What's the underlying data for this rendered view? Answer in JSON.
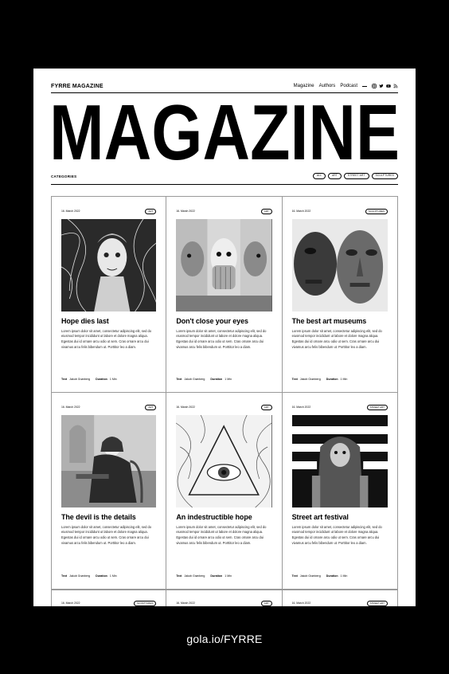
{
  "brand": "FYRRE MAGAZINE",
  "nav": {
    "items": [
      "Magazine",
      "Authors",
      "Podcast"
    ]
  },
  "masthead": "MAGAZINE",
  "categories": {
    "label": "CATEGORIES",
    "filters": [
      "ALL",
      "ART",
      "STREET ART",
      "SCULPTURES"
    ]
  },
  "articles": [
    {
      "date": "16. March 2022",
      "tag": "ART",
      "title": "Hope dies last",
      "excerpt": "Lorem ipsum dolor sit amet, consectetur adipiscing elit, sed do eiusmod tempor incididunt ut labore et dolore magna aliqua. Egestas dui id ornare arcu odio ut sem. Cras ornare arcu dui vivamus arcu felis bibendum ut. Porttitor leo a diam.",
      "text_label": "Text",
      "author": "Jakob Grønberg",
      "duration_label": "Duration",
      "duration": "1 Min"
    },
    {
      "date": "16. March 2022",
      "tag": "ART",
      "title": "Don't close your eyes",
      "excerpt": "Lorem ipsum dolor sit amet, consectetur adipiscing elit, sed do eiusmod tempor incididunt ut labore et dolore magna aliqua. Egestas dui id ornare arcu odio ut sem. Cras ornare arcu dui vivamus arcu felis bibendum ut. Porttitor leo a diam.",
      "text_label": "Text",
      "author": "Jakob Grønberg",
      "duration_label": "Duration",
      "duration": "1 Min"
    },
    {
      "date": "16. March 2022",
      "tag": "SCULPTURES",
      "title": "The best art museums",
      "excerpt": "Lorem ipsum dolor sit amet, consectetur adipiscing elit, sed do eiusmod tempor incididunt ut labore et dolore magna aliqua. Egestas dui id ornare arcu odio ut sem. Cras ornare arcu dui vivamus arcu felis bibendum ut. Porttitor leo a diam.",
      "text_label": "Text",
      "author": "Jakob Grønberg",
      "duration_label": "Duration",
      "duration": "1 Min"
    },
    {
      "date": "16. March 2022",
      "tag": "ART",
      "title": "The devil is the details",
      "excerpt": "Lorem ipsum dolor sit amet, consectetur adipiscing elit, sed do eiusmod tempor incididunt ut labore et dolore magna aliqua. Egestas dui id ornare arcu odio ut sem. Cras ornare arcu dui vivamus arcu felis bibendum ut. Porttitor leo a diam.",
      "text_label": "Text",
      "author": "Jakob Grønberg",
      "duration_label": "Duration",
      "duration": "1 Min"
    },
    {
      "date": "16. March 2022",
      "tag": "ART",
      "title": "An indestructible hope",
      "excerpt": "Lorem ipsum dolor sit amet, consectetur adipiscing elit, sed do eiusmod tempor incididunt ut labore et dolore magna aliqua. Egestas dui id ornare arcu odio ut sem. Cras ornare arcu dui vivamus arcu felis bibendum ut. Porttitor leo a diam.",
      "text_label": "Text",
      "author": "Jakob Grønberg",
      "duration_label": "Duration",
      "duration": "1 Min"
    },
    {
      "date": "16. March 2022",
      "tag": "STREET ART",
      "title": "Street art festival",
      "excerpt": "Lorem ipsum dolor sit amet, consectetur adipiscing elit, sed do eiusmod tempor incididunt ut labore et dolore magna aliqua. Egestas dui id ornare arcu odio ut sem. Cras ornare arcu dui vivamus arcu felis bibendum ut. Porttitor leo a diam.",
      "text_label": "Text",
      "author": "Jakob Grønberg",
      "duration_label": "Duration",
      "duration": "1 Min"
    }
  ],
  "partial_row": [
    {
      "date": "16. March 2022",
      "tag": "SCULPTURES"
    },
    {
      "date": "16. March 2022",
      "tag": "ART"
    },
    {
      "date": "16. March 2022",
      "tag": "STREET ART"
    }
  ],
  "social_icons": [
    "instagram-icon",
    "twitter-icon",
    "youtube-icon",
    "rss-icon"
  ],
  "footer_url": "gola.io/FYRRE",
  "colors": {
    "background": "#000000",
    "page": "#ffffff",
    "text": "#000000"
  }
}
